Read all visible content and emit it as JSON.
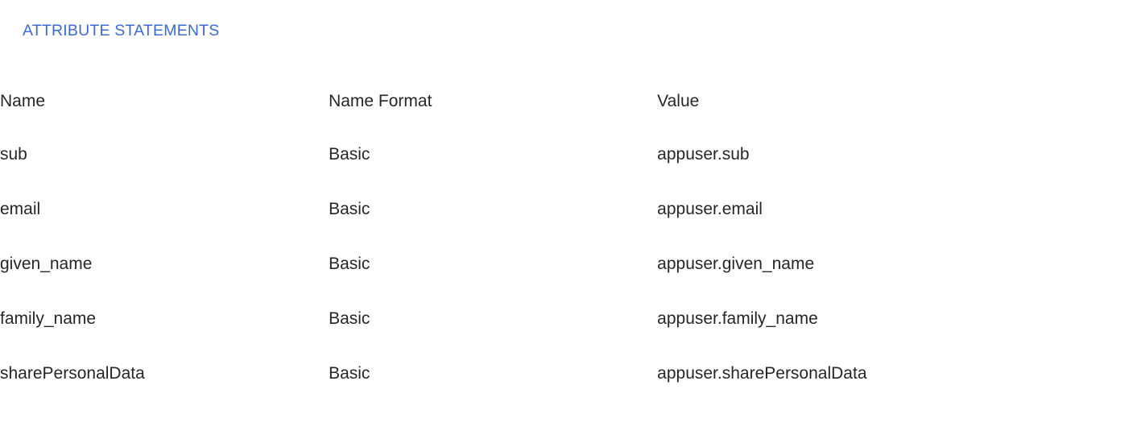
{
  "section": {
    "heading": "ATTRIBUTE STATEMENTS",
    "heading_color": "#3c6ad6"
  },
  "table": {
    "columns": [
      {
        "key": "name",
        "label": "Name"
      },
      {
        "key": "format",
        "label": "Name Format"
      },
      {
        "key": "value",
        "label": "Value"
      }
    ],
    "rows": [
      {
        "name": "sub",
        "format": "Basic",
        "value": "appuser.sub"
      },
      {
        "name": "email",
        "format": "Basic",
        "value": "appuser.email"
      },
      {
        "name": "given_name",
        "format": "Basic",
        "value": "appuser.given_name"
      },
      {
        "name": "family_name",
        "format": "Basic",
        "value": "appuser.family_name"
      },
      {
        "name": "sharePersonalData",
        "format": "Basic",
        "value": "appuser.sharePersonalData"
      }
    ]
  },
  "colors": {
    "background": "#ffffff",
    "text": "#262626",
    "accent": "#3c6ad6"
  }
}
